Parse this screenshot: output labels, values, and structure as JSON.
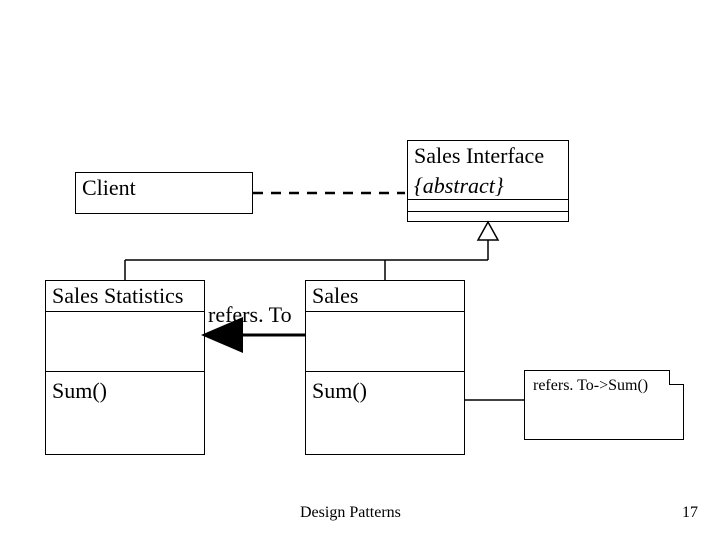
{
  "classes": {
    "client": {
      "name": "Client"
    },
    "sales_interface": {
      "name": "Sales Interface",
      "stereotype": "{abstract}"
    },
    "sales_statistics": {
      "name": "Sales Statistics",
      "operation": "Sum()"
    },
    "sales": {
      "name": "Sales",
      "operation": "Sum()"
    }
  },
  "association": {
    "refers_to_label": "refers. To"
  },
  "note": {
    "text": "refers. To->Sum()"
  },
  "footer": {
    "caption": "Design Patterns",
    "slide_number": "17"
  }
}
